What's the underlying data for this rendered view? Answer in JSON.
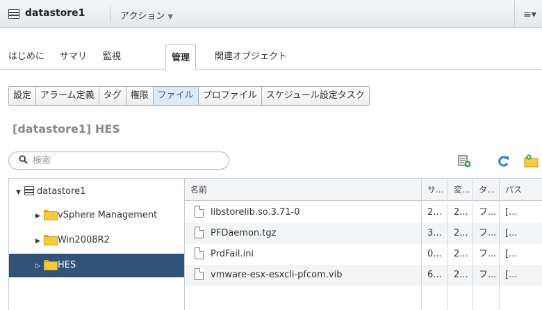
{
  "header": {
    "title": "datastore1",
    "actions_label": "アクション",
    "actions_caret": "▼",
    "menu_glyph": "≡▾"
  },
  "tabs": [
    {
      "label": "はじめに",
      "active": false
    },
    {
      "label": "サマリ",
      "active": false
    },
    {
      "label": "監視",
      "active": false
    },
    {
      "label": "管理",
      "active": true
    },
    {
      "label": "関連オブジェクト",
      "active": false
    }
  ],
  "subtabs": [
    {
      "label": "設定",
      "active": false
    },
    {
      "label": "アラーム定義",
      "active": false
    },
    {
      "label": "タグ",
      "active": false
    },
    {
      "label": "権限",
      "active": false
    },
    {
      "label": "ファイル",
      "active": true
    },
    {
      "label": "プロファイル",
      "active": false
    },
    {
      "label": "スケジュール設定タスク",
      "active": false
    }
  ],
  "path_title": "[datastore1] HES",
  "search": {
    "placeholder": "検索",
    "value": ""
  },
  "toolbar": {
    "icons": [
      "new-file-icon",
      "refresh-icon",
      "new-folder-icon"
    ]
  },
  "tree": [
    {
      "label": "datastore1",
      "expanded": true,
      "icon": "datastore-icon",
      "selected": false
    },
    {
      "label": "vSphere Management",
      "expanded": false,
      "icon": "folder-icon",
      "selected": false
    },
    {
      "label": "Win2008R2",
      "expanded": false,
      "icon": "folder-icon",
      "selected": false
    },
    {
      "label": "HES",
      "expanded": false,
      "icon": "folder-icon",
      "selected": true
    }
  ],
  "files": {
    "columns": [
      "名前",
      "サ...",
      "変...",
      "タ...",
      "パス"
    ],
    "rows": [
      {
        "name": "libstorelib.so.3.71-0",
        "size": "2...",
        "modified": "2...",
        "type": "フ...",
        "path": "[..."
      },
      {
        "name": "PFDaemon.tgz",
        "size": "3...",
        "modified": "2...",
        "type": "フ...",
        "path": "[..."
      },
      {
        "name": "PrdFail.ini",
        "size": "0...",
        "modified": "2...",
        "type": "フ...",
        "path": "[..."
      },
      {
        "name": "vmware-esx-esxcli-pfcom.vib",
        "size": "6...",
        "modified": "2...",
        "type": "フ...",
        "path": "[..."
      }
    ]
  },
  "colors": {
    "accent": "#2a6ab5",
    "selection": "#315377",
    "refresh": "#2a7fd0",
    "folder": "#f6c93f"
  }
}
